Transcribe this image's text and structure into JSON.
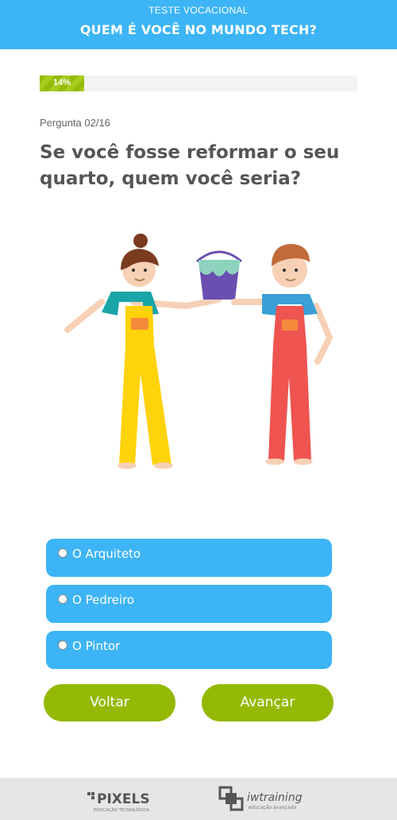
{
  "header": {
    "subtitle": "TESTE VOCACIONAL",
    "title": "QUEM É VOCÊ NO MUNDO TECH?"
  },
  "progress": {
    "value_percent": 14,
    "label": "14%"
  },
  "question": {
    "counter": "Pergunta 02/16",
    "text": "Se você fosse reformar o seu quarto, quem você seria?"
  },
  "options": [
    {
      "label": "O Arquiteto",
      "selected": false
    },
    {
      "label": "O Pedreiro",
      "selected": false
    },
    {
      "label": "O Pintor",
      "selected": false
    }
  ],
  "buttons": {
    "back": "Voltar",
    "next": "Avançar"
  },
  "footer": {
    "logo_pixels": "PIXELS",
    "logo_pixels_tagline": "EDUCAÇÃO TECNOLÓGICA",
    "logo_iw": "iwtraining",
    "logo_iw_tagline": "educação avançada"
  },
  "colors": {
    "primary_blue": "#3cb4f5",
    "accent_green": "#93b904",
    "text_gray": "#555555"
  }
}
